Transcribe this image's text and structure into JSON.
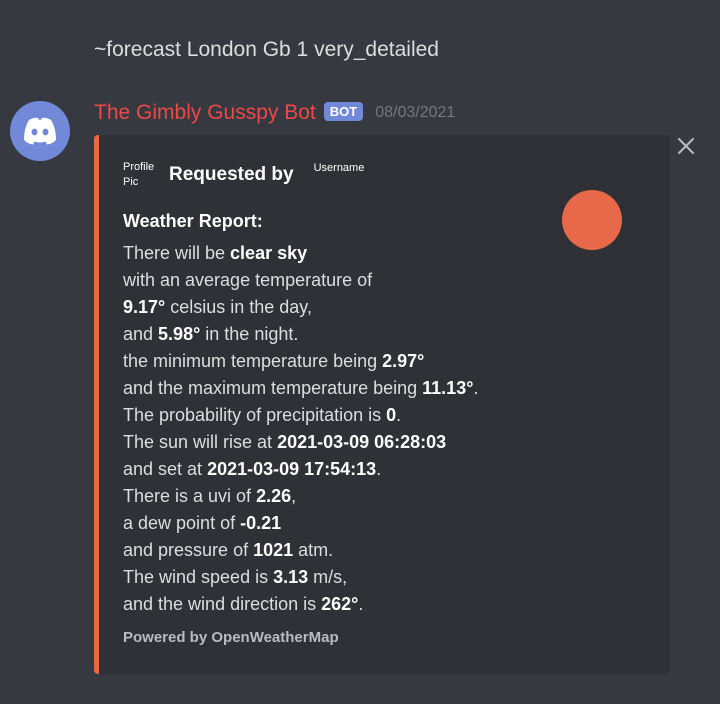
{
  "command": "~forecast London Gb 1 very_detailed",
  "bot": {
    "name": "The Gimbly Gusspy Bot",
    "badge": "BOT",
    "timestamp": "08/03/2021",
    "avatar_icon": "discord-logo-icon"
  },
  "embed": {
    "accent_color": "#e8694a",
    "author": {
      "pic_alt": "Profile Pic",
      "label": "Requested by",
      "username": "Username"
    },
    "title": "Weather Report:",
    "lines": [
      [
        "There will be ",
        "clear sky",
        ""
      ],
      [
        "with an average temperature of",
        "",
        ""
      ],
      [
        "",
        "9.17°",
        " celsius in the day,"
      ],
      [
        "and ",
        "5.98°",
        " in the night."
      ],
      [
        "the minimum temperature being ",
        "2.97°",
        ""
      ],
      [
        "and the maximum temperature being ",
        "11.13°",
        "."
      ],
      [
        "The probability of precipitation is ",
        "0",
        "."
      ],
      [
        "The sun will rise at ",
        "2021-03-09 06:28:03",
        ""
      ],
      [
        "and set at ",
        "2021-03-09 17:54:13",
        "."
      ],
      [
        "There is a uvi of ",
        "2.26",
        ","
      ],
      [
        "a dew point of ",
        "-0.21",
        ""
      ],
      [
        "and pressure of ",
        "1021",
        " atm."
      ],
      [
        "The wind speed is ",
        "3.13",
        " m/s,"
      ],
      [
        "and the wind direction is ",
        "262°",
        "."
      ]
    ],
    "footer": "Powered by OpenWeatherMap"
  }
}
